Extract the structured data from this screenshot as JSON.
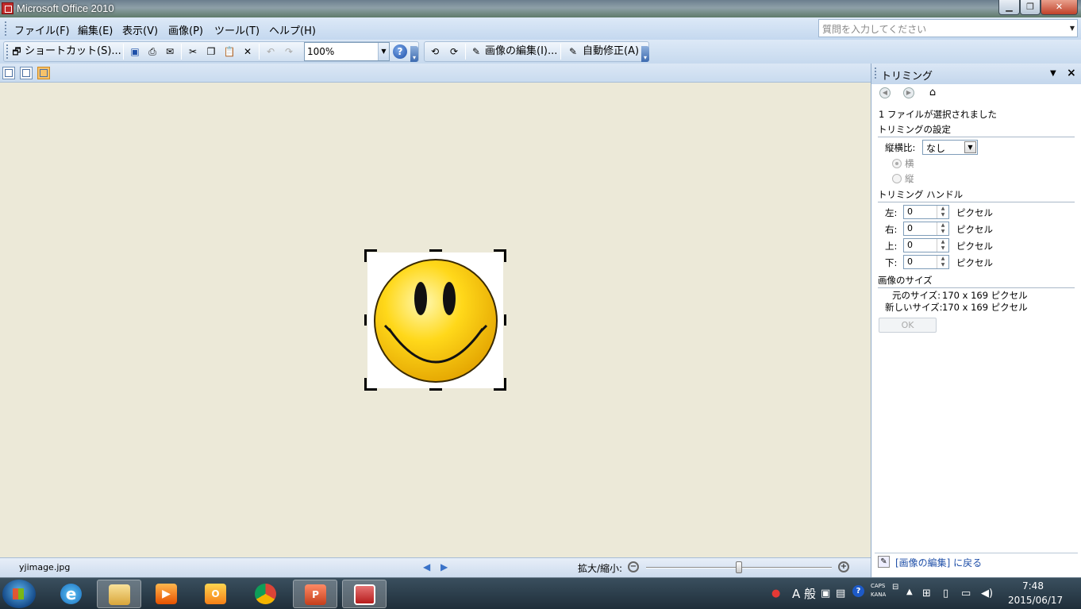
{
  "window": {
    "title": "Microsoft Office 2010",
    "minimize": "▁",
    "restore": "❐",
    "close": "✕"
  },
  "menu": {
    "items": [
      "ファイル(F)",
      "編集(E)",
      "表示(V)",
      "画像(P)",
      "ツール(T)",
      "ヘルプ(H)"
    ],
    "help_placeholder": "質問を入力してください"
  },
  "toolbar": {
    "shortcut_label": "ショートカット(S)...",
    "zoom_value": "100%",
    "edit_picture_label": "画像の編集(I)...",
    "auto_correct_label": "自動修正(A)"
  },
  "status": {
    "filename": "yjimage.jpg",
    "zoom_label": "拡大/縮小:",
    "zoom_slider_fraction": 0.5
  },
  "pane": {
    "title": "トリミング",
    "selected_info": "1 ファイルが選択されました",
    "crop_settings_heading": "トリミングの設定",
    "aspect_label": "縦横比:",
    "aspect_value": "なし",
    "orientation_landscape": "横",
    "orientation_portrait": "縦",
    "handles_heading": "トリミング ハンドル",
    "handles": [
      {
        "label": "左:",
        "value": "0",
        "unit": "ピクセル"
      },
      {
        "label": "右:",
        "value": "0",
        "unit": "ピクセル"
      },
      {
        "label": "上:",
        "value": "0",
        "unit": "ピクセル"
      },
      {
        "label": "下:",
        "value": "0",
        "unit": "ピクセル"
      }
    ],
    "size_heading": "画像のサイズ",
    "original_size_label": "元のサイズ:",
    "original_size_value": "170 x 169 ピクセル",
    "new_size_label": "新しいサイズ:",
    "new_size_value": "170 x 169 ピクセル",
    "ok_label": "OK",
    "back_link": "[画像の編集] に戻る"
  },
  "taskbar": {
    "ime_mode": "A 般",
    "caps": "CAPS",
    "kana": "KANA",
    "time": "7:48",
    "date": "2015/06/17"
  },
  "colors": {
    "accent": "#1f4fa8",
    "canvas_bg": "#ece9d8",
    "titlebar": "#6b7e8e"
  }
}
